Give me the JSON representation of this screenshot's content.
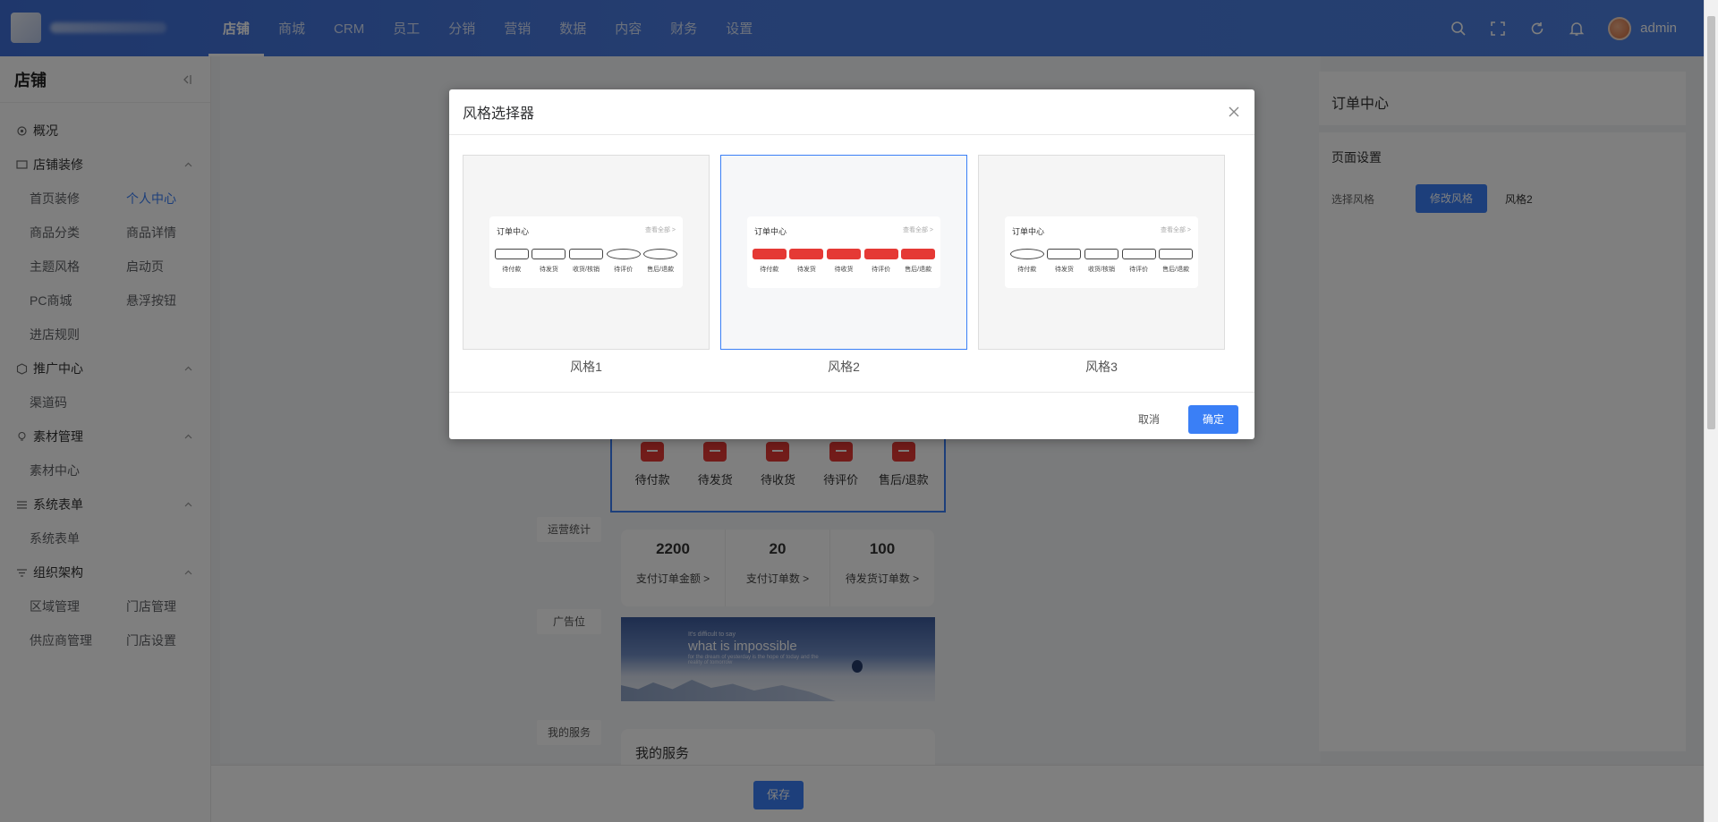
{
  "header": {
    "nav": [
      "店铺",
      "商城",
      "CRM",
      "员工",
      "分销",
      "营销",
      "数据",
      "内容",
      "财务",
      "设置"
    ],
    "username": "admin"
  },
  "sidebar": {
    "title": "店铺",
    "overview": "概况",
    "groups": [
      {
        "label": "店铺装修",
        "items": [
          "首页装修",
          "个人中心",
          "商品分类",
          "商品详情",
          "主题风格",
          "启动页",
          "PC商城",
          "悬浮按钮",
          "进店规则"
        ]
      },
      {
        "label": "推广中心",
        "items": [
          "渠道码"
        ]
      },
      {
        "label": "素材管理",
        "items": [
          "素材中心"
        ]
      },
      {
        "label": "系统表单",
        "items": [
          "系统表单"
        ]
      },
      {
        "label": "组织架构",
        "items": [
          "区域管理",
          "门店管理",
          "供应商管理",
          "门店设置"
        ]
      }
    ]
  },
  "preview": {
    "tags": {
      "stats": "运营统计",
      "ad": "广告位",
      "services": "我的服务"
    },
    "order_items": [
      "待付款",
      "待发货",
      "待收货",
      "待评价",
      "售后/退款"
    ],
    "stats": [
      {
        "value": "2200",
        "label": "支付订单金额 >"
      },
      {
        "value": "20",
        "label": "支付订单数 >"
      },
      {
        "value": "100",
        "label": "待发货订单数 >"
      }
    ],
    "banner": {
      "small": "It's difficult to say",
      "big": "what is impossible",
      "sub": "for the dream of yesterday is the hope of today and the reality of tomorrow"
    },
    "services_title": "我的服务"
  },
  "right_panel": {
    "title": "订单中心",
    "section": "页面设置",
    "label": "选择风格",
    "button": "修改风格",
    "value": "风格2"
  },
  "save_label": "保存",
  "modal": {
    "title": "风格选择器",
    "options": [
      {
        "name": "风格1",
        "header": "订单中心",
        "view_all": "查看全部 >",
        "items": [
          "待付款",
          "待发货",
          "收货/核销",
          "待评价",
          "售后/退款"
        ]
      },
      {
        "name": "风格2",
        "header": "订单中心",
        "view_all": "查看全部 >",
        "items": [
          "待付款",
          "待发货",
          "待收货",
          "待评价",
          "售后/退款"
        ]
      },
      {
        "name": "风格3",
        "header": "订单中心",
        "view_all": "查看全部 >",
        "items": [
          "待付款",
          "待发货",
          "收货/核销",
          "待评价",
          "售后/退款"
        ]
      }
    ],
    "cancel": "取消",
    "ok": "确定"
  },
  "colors": {
    "accent": "#3a7ff6",
    "brand_red": "#e53935",
    "header_blue": "#4a7be0"
  }
}
